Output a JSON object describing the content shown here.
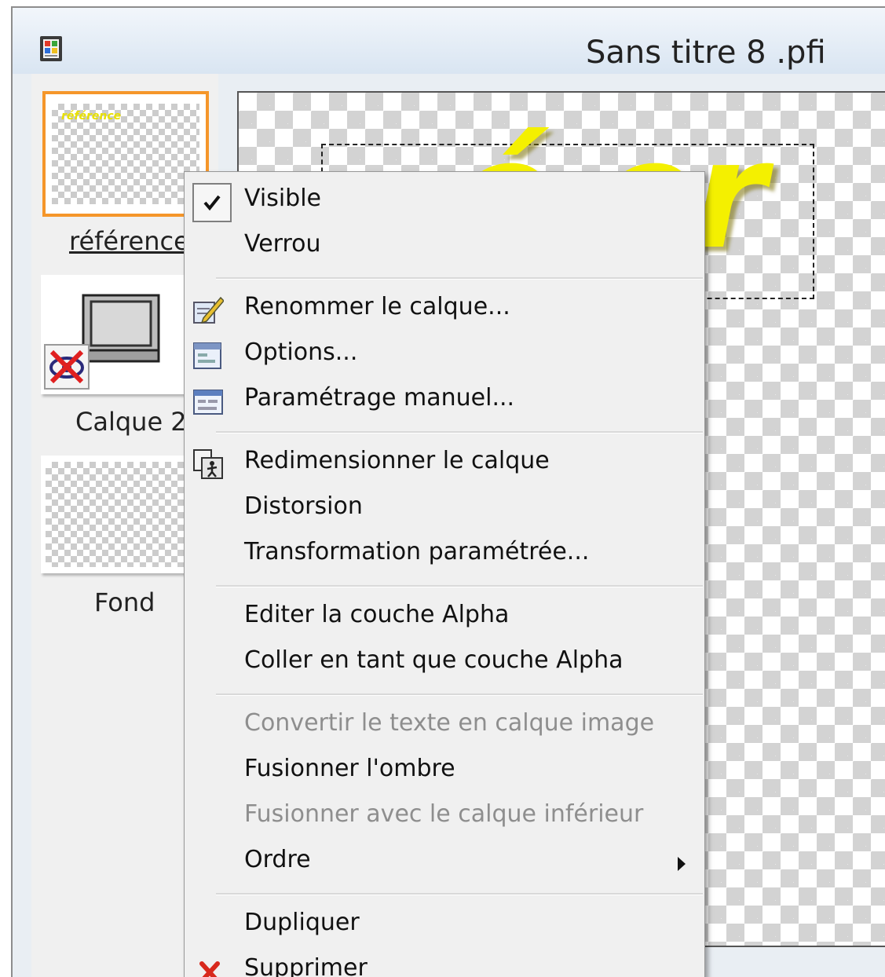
{
  "window": {
    "title": "Sans titre 8 .pfi",
    "icon": "film-strip-icon"
  },
  "layers": [
    {
      "label": "référence",
      "selected": true,
      "underlined": true,
      "thumb_text": "référence"
    },
    {
      "label": "Calque 2",
      "selected": false,
      "hidden_icon": "eye-crossed-icon",
      "thumb_icon": "monitor-icon"
    },
    {
      "label": "Fond",
      "selected": false
    }
  ],
  "canvas": {
    "text": "é er",
    "text_color": "#f4f000"
  },
  "menu": {
    "items": [
      {
        "label": "Visible",
        "checked": true,
        "enabled": true
      },
      {
        "label": "Verrou",
        "enabled": true
      },
      {
        "label": "Renommer le calque...",
        "icon": "rename-pencil-icon",
        "enabled": true
      },
      {
        "label": "Options...",
        "icon": "options-window-icon",
        "enabled": true
      },
      {
        "label": "Paramétrage manuel...",
        "icon": "manual-settings-icon",
        "enabled": true
      },
      {
        "label": "Redimensionner le calque",
        "icon": "resize-layer-icon",
        "enabled": true
      },
      {
        "label": "Distorsion",
        "enabled": true
      },
      {
        "label": "Transformation paramétrée...",
        "enabled": true
      },
      {
        "label": "Editer la couche Alpha",
        "enabled": true
      },
      {
        "label": "Coller en tant que couche Alpha",
        "enabled": true
      },
      {
        "label": "Convertir le texte en calque image",
        "enabled": false
      },
      {
        "label": "Fusionner l'ombre",
        "enabled": true
      },
      {
        "label": "Fusionner avec le calque inférieur",
        "enabled": false
      },
      {
        "label": "Ordre",
        "submenu": true,
        "enabled": true
      },
      {
        "label": "Dupliquer",
        "enabled": true
      },
      {
        "label": "Supprimer",
        "icon": "delete-x-icon",
        "enabled": true
      }
    ]
  },
  "colors": {
    "selection_orange": "#f5962a",
    "disabled_text": "#8e8e8e",
    "delete_red": "#d8281c"
  }
}
